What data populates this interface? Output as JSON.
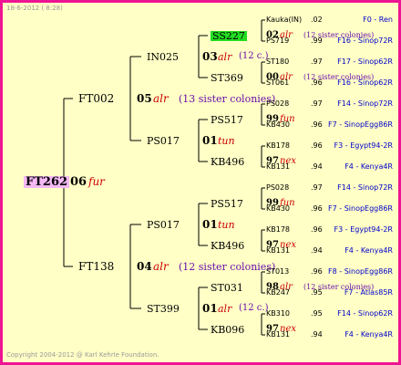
{
  "header": {
    "date": "18-6-2012 ( 8:28)"
  },
  "footer": {
    "copyright": "Copyright 2004-2012 @ Karl Kehrle Foundation."
  },
  "root": {
    "id": "FT262",
    "year": "06",
    "breeder": "fur"
  },
  "gen1": [
    {
      "id": "FT002",
      "year": "05",
      "breeder": "alr",
      "note": "(13 sister colonies)"
    },
    {
      "id": "FT138",
      "year": "04",
      "breeder": "alr",
      "note": "(12 sister colonies)"
    }
  ],
  "gen2": [
    {
      "id": "IN025",
      "year": "03",
      "breeder": "alr",
      "note": "(12 c.)"
    },
    {
      "id": "PS017",
      "year": "01",
      "breeder": "tun",
      "note": ""
    },
    {
      "id": "PS017",
      "year": "01",
      "breeder": "tun",
      "note": ""
    },
    {
      "id": "ST399",
      "year": "01",
      "breeder": "alr",
      "note": "(12 c.)"
    }
  ],
  "gen3": [
    {
      "id": "SS227",
      "year": "02",
      "breeder": "alr",
      "note": "(12 sister colonies)"
    },
    {
      "id": "ST369",
      "year": "00",
      "breeder": "alr",
      "note": "(12 sister colonies)"
    },
    {
      "id": "PS517",
      "year": "99",
      "breeder": "fun",
      "note": ""
    },
    {
      "id": "KB496",
      "year": "97",
      "breeder": "nex",
      "note": ""
    },
    {
      "id": "PS517",
      "year": "99",
      "breeder": "fun",
      "note": ""
    },
    {
      "id": "KB496",
      "year": "97",
      "breeder": "nex",
      "note": ""
    },
    {
      "id": "ST031",
      "year": "98",
      "breeder": "alr",
      "note": "(12 sister colonies)"
    },
    {
      "id": "KB096",
      "year": "97",
      "breeder": "nex",
      "note": ""
    }
  ],
  "gen4": [
    {
      "id": "Kauka(IN)",
      "year": ".02",
      "line": "F0 - Ren"
    },
    {
      "id": "PS719",
      "year": ".99",
      "line": "F16 - Sinop72R"
    },
    {
      "id": "ST180",
      "year": ".97",
      "line": "F17 - Sinop62R"
    },
    {
      "id": "ST061",
      "year": ".96",
      "line": "F16 - Sinop62R"
    },
    {
      "id": "PS028",
      "year": ".97",
      "line": "F14 - Sinop72R"
    },
    {
      "id": "KB430",
      "year": ".96",
      "line": "F7 - SinopEgg86R"
    },
    {
      "id": "KB178",
      "year": ".96",
      "line": "F3 - Egypt94-2R"
    },
    {
      "id": "KB131",
      "year": ".94",
      "line": "F4 - Kenya4R"
    },
    {
      "id": "PS028",
      "year": ".97",
      "line": "F14 - Sinop72R"
    },
    {
      "id": "KB430",
      "year": ".96",
      "line": "F7 - SinopEgg86R"
    },
    {
      "id": "KB178",
      "year": ".96",
      "line": "F3 - Egypt94-2R"
    },
    {
      "id": "KB131",
      "year": ".94",
      "line": "F4 - Kenya4R"
    },
    {
      "id": "ST013",
      "year": ".96",
      "line": "F8 - SinopEgg86R"
    },
    {
      "id": "KB247",
      "year": ".95",
      "line": "F7 - Atlas85R"
    },
    {
      "id": "KB310",
      "year": ".95",
      "line": "F14 - Sinop62R"
    },
    {
      "id": "KB131",
      "year": ".94",
      "line": "F4 - Kenya4R"
    }
  ],
  "colors": {
    "border": "#ee1493",
    "background": "#ffffc6",
    "root_highlight": "#f4b8f4",
    "highlight_green": "#22dd22",
    "breeder_red": "#cc0000",
    "note_purple": "#6a0dad",
    "line_blue": "#0000cc"
  }
}
